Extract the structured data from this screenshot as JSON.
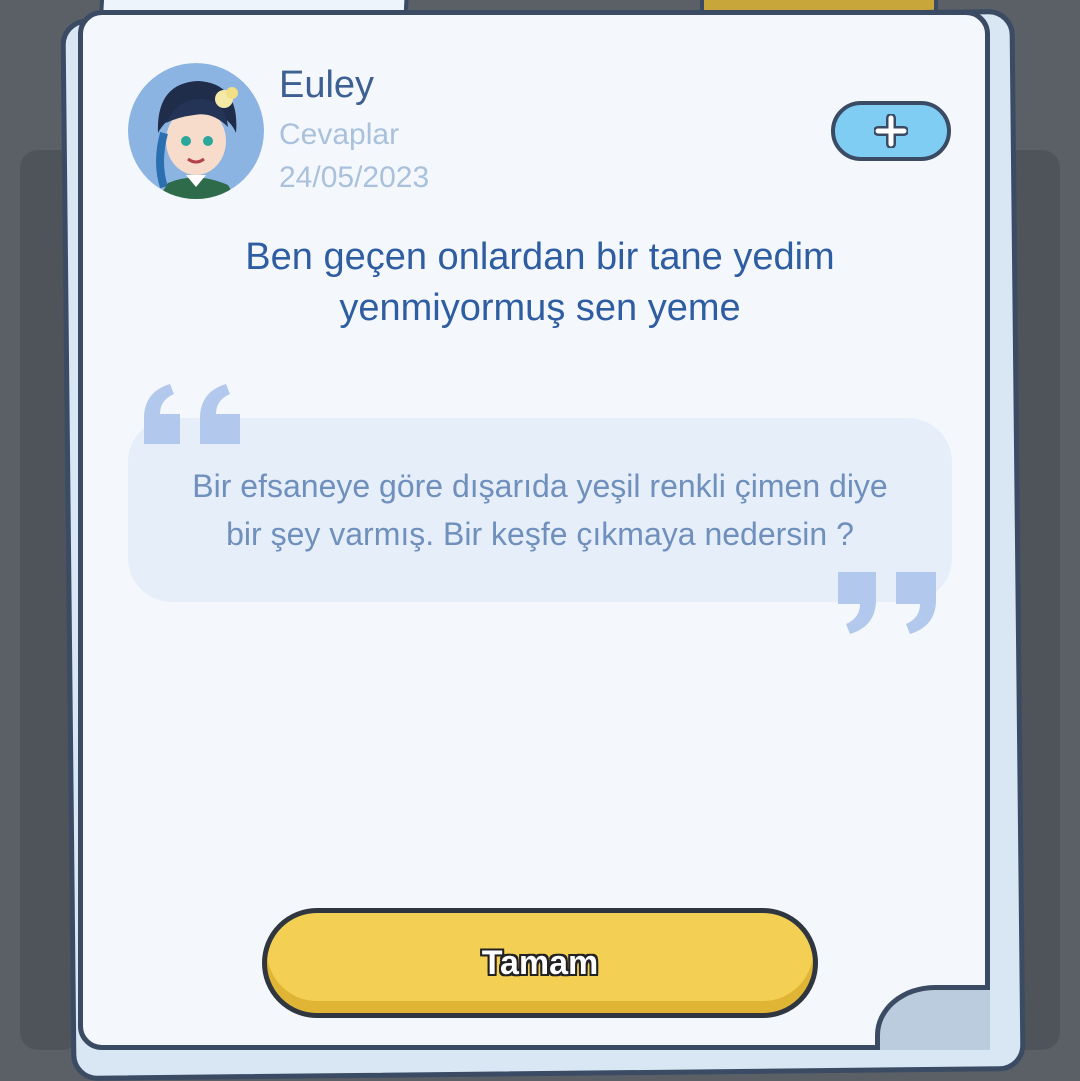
{
  "user": {
    "name": "Euley",
    "subtitle": "Cevaplar",
    "date": "24/05/2023",
    "avatar_icon": "anime-character-avatar"
  },
  "add_button": {
    "icon": "plus-icon"
  },
  "message": {
    "line1": "Ben geçen onlardan bir tane yedim",
    "line2": "yenmiyormuş sen yeme"
  },
  "quote": {
    "line1": "Bir efsaneye göre dışarıda yeşil renkli çimen diye",
    "line2": "bir şey varmış. Bir keşfe çıkmaya nedersin ?"
  },
  "ok_button": {
    "label": "Tamam"
  },
  "colors": {
    "accent_blue": "#2f5da1",
    "button_yellow": "#f3d054",
    "add_button_blue": "#7fcdf3"
  }
}
